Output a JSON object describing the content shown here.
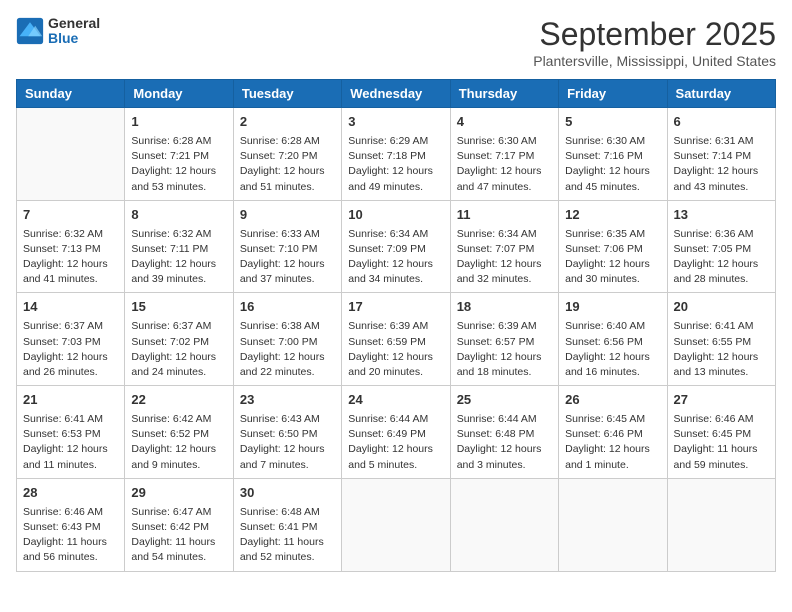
{
  "logo": {
    "general": "General",
    "blue": "Blue"
  },
  "header": {
    "month": "September 2025",
    "location": "Plantersville, Mississippi, United States"
  },
  "days_of_week": [
    "Sunday",
    "Monday",
    "Tuesday",
    "Wednesday",
    "Thursday",
    "Friday",
    "Saturday"
  ],
  "weeks": [
    [
      {
        "day": "",
        "data": ""
      },
      {
        "day": "1",
        "data": "Sunrise: 6:28 AM\nSunset: 7:21 PM\nDaylight: 12 hours and 53 minutes."
      },
      {
        "day": "2",
        "data": "Sunrise: 6:28 AM\nSunset: 7:20 PM\nDaylight: 12 hours and 51 minutes."
      },
      {
        "day": "3",
        "data": "Sunrise: 6:29 AM\nSunset: 7:18 PM\nDaylight: 12 hours and 49 minutes."
      },
      {
        "day": "4",
        "data": "Sunrise: 6:30 AM\nSunset: 7:17 PM\nDaylight: 12 hours and 47 minutes."
      },
      {
        "day": "5",
        "data": "Sunrise: 6:30 AM\nSunset: 7:16 PM\nDaylight: 12 hours and 45 minutes."
      },
      {
        "day": "6",
        "data": "Sunrise: 6:31 AM\nSunset: 7:14 PM\nDaylight: 12 hours and 43 minutes."
      }
    ],
    [
      {
        "day": "7",
        "data": "Sunrise: 6:32 AM\nSunset: 7:13 PM\nDaylight: 12 hours and 41 minutes."
      },
      {
        "day": "8",
        "data": "Sunrise: 6:32 AM\nSunset: 7:11 PM\nDaylight: 12 hours and 39 minutes."
      },
      {
        "day": "9",
        "data": "Sunrise: 6:33 AM\nSunset: 7:10 PM\nDaylight: 12 hours and 37 minutes."
      },
      {
        "day": "10",
        "data": "Sunrise: 6:34 AM\nSunset: 7:09 PM\nDaylight: 12 hours and 34 minutes."
      },
      {
        "day": "11",
        "data": "Sunrise: 6:34 AM\nSunset: 7:07 PM\nDaylight: 12 hours and 32 minutes."
      },
      {
        "day": "12",
        "data": "Sunrise: 6:35 AM\nSunset: 7:06 PM\nDaylight: 12 hours and 30 minutes."
      },
      {
        "day": "13",
        "data": "Sunrise: 6:36 AM\nSunset: 7:05 PM\nDaylight: 12 hours and 28 minutes."
      }
    ],
    [
      {
        "day": "14",
        "data": "Sunrise: 6:37 AM\nSunset: 7:03 PM\nDaylight: 12 hours and 26 minutes."
      },
      {
        "day": "15",
        "data": "Sunrise: 6:37 AM\nSunset: 7:02 PM\nDaylight: 12 hours and 24 minutes."
      },
      {
        "day": "16",
        "data": "Sunrise: 6:38 AM\nSunset: 7:00 PM\nDaylight: 12 hours and 22 minutes."
      },
      {
        "day": "17",
        "data": "Sunrise: 6:39 AM\nSunset: 6:59 PM\nDaylight: 12 hours and 20 minutes."
      },
      {
        "day": "18",
        "data": "Sunrise: 6:39 AM\nSunset: 6:57 PM\nDaylight: 12 hours and 18 minutes."
      },
      {
        "day": "19",
        "data": "Sunrise: 6:40 AM\nSunset: 6:56 PM\nDaylight: 12 hours and 16 minutes."
      },
      {
        "day": "20",
        "data": "Sunrise: 6:41 AM\nSunset: 6:55 PM\nDaylight: 12 hours and 13 minutes."
      }
    ],
    [
      {
        "day": "21",
        "data": "Sunrise: 6:41 AM\nSunset: 6:53 PM\nDaylight: 12 hours and 11 minutes."
      },
      {
        "day": "22",
        "data": "Sunrise: 6:42 AM\nSunset: 6:52 PM\nDaylight: 12 hours and 9 minutes."
      },
      {
        "day": "23",
        "data": "Sunrise: 6:43 AM\nSunset: 6:50 PM\nDaylight: 12 hours and 7 minutes."
      },
      {
        "day": "24",
        "data": "Sunrise: 6:44 AM\nSunset: 6:49 PM\nDaylight: 12 hours and 5 minutes."
      },
      {
        "day": "25",
        "data": "Sunrise: 6:44 AM\nSunset: 6:48 PM\nDaylight: 12 hours and 3 minutes."
      },
      {
        "day": "26",
        "data": "Sunrise: 6:45 AM\nSunset: 6:46 PM\nDaylight: 12 hours and 1 minute."
      },
      {
        "day": "27",
        "data": "Sunrise: 6:46 AM\nSunset: 6:45 PM\nDaylight: 11 hours and 59 minutes."
      }
    ],
    [
      {
        "day": "28",
        "data": "Sunrise: 6:46 AM\nSunset: 6:43 PM\nDaylight: 11 hours and 56 minutes."
      },
      {
        "day": "29",
        "data": "Sunrise: 6:47 AM\nSunset: 6:42 PM\nDaylight: 11 hours and 54 minutes."
      },
      {
        "day": "30",
        "data": "Sunrise: 6:48 AM\nSunset: 6:41 PM\nDaylight: 11 hours and 52 minutes."
      },
      {
        "day": "",
        "data": ""
      },
      {
        "day": "",
        "data": ""
      },
      {
        "day": "",
        "data": ""
      },
      {
        "day": "",
        "data": ""
      }
    ]
  ]
}
